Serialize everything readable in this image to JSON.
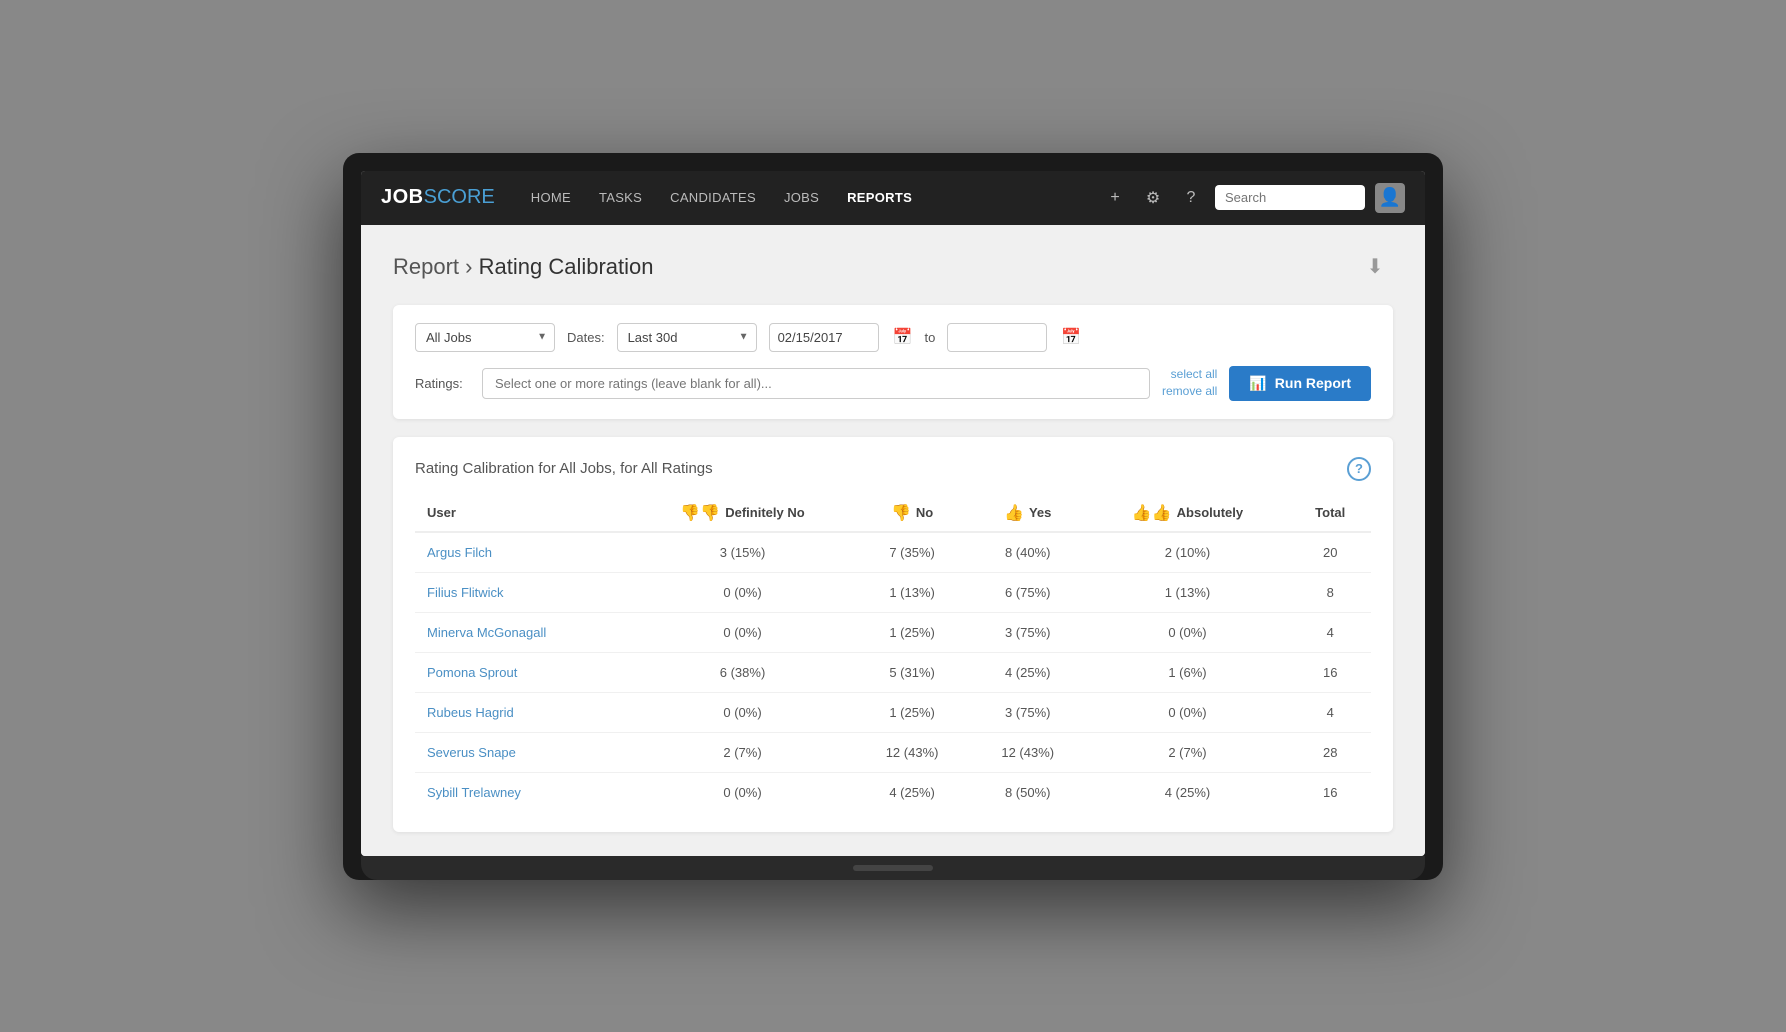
{
  "app": {
    "logo_job": "JOB",
    "logo_score": "SCORE"
  },
  "nav": {
    "links": [
      {
        "label": "HOME",
        "active": false
      },
      {
        "label": "TASKS",
        "active": false
      },
      {
        "label": "CANDIDATES",
        "active": false
      },
      {
        "label": "JOBS",
        "active": false
      },
      {
        "label": "REPORTS",
        "active": true
      }
    ],
    "search_placeholder": "Search",
    "icons": {
      "add": "+",
      "settings": "⚙",
      "help": "?"
    }
  },
  "breadcrumb": {
    "parent": "Report",
    "separator": ">",
    "current": "Rating Calibration"
  },
  "filters": {
    "jobs_options": [
      "All Jobs"
    ],
    "jobs_selected": "All Jobs",
    "dates_label": "Dates:",
    "date_range_options": [
      "Last 30d"
    ],
    "date_range_selected": "Last 30d",
    "date_from": "02/15/2017",
    "date_to": "",
    "to_label": "to",
    "ratings_label": "Ratings:",
    "ratings_placeholder": "Select one or more ratings (leave blank for all)...",
    "select_all": "select all",
    "remove_all": "remove all",
    "run_report_label": "Run Report"
  },
  "table": {
    "title": "Rating Calibration for All Jobs, for All Ratings",
    "columns": [
      {
        "key": "user",
        "label": "User",
        "icon": null
      },
      {
        "key": "definitely_no",
        "label": "Definitely No",
        "icon": "👎👎"
      },
      {
        "key": "no",
        "label": "No",
        "icon": "👎"
      },
      {
        "key": "yes",
        "label": "Yes",
        "icon": "👍"
      },
      {
        "key": "absolutely",
        "label": "Absolutely",
        "icon": "👍👍"
      },
      {
        "key": "total",
        "label": "Total",
        "icon": null
      }
    ],
    "rows": [
      {
        "user": "Argus Filch",
        "definitely_no": "3 (15%)",
        "no": "7 (35%)",
        "yes": "8 (40%)",
        "absolutely": "2 (10%)",
        "total": "20"
      },
      {
        "user": "Filius Flitwick",
        "definitely_no": "0 (0%)",
        "no": "1 (13%)",
        "yes": "6 (75%)",
        "absolutely": "1 (13%)",
        "total": "8"
      },
      {
        "user": "Minerva McGonagall",
        "definitely_no": "0 (0%)",
        "no": "1 (25%)",
        "yes": "3 (75%)",
        "absolutely": "0 (0%)",
        "total": "4"
      },
      {
        "user": "Pomona Sprout",
        "definitely_no": "6 (38%)",
        "no": "5 (31%)",
        "yes": "4 (25%)",
        "absolutely": "1 (6%)",
        "total": "16"
      },
      {
        "user": "Rubeus Hagrid",
        "definitely_no": "0 (0%)",
        "no": "1 (25%)",
        "yes": "3 (75%)",
        "absolutely": "0 (0%)",
        "total": "4"
      },
      {
        "user": "Severus Snape",
        "definitely_no": "2 (7%)",
        "no": "12 (43%)",
        "yes": "12 (43%)",
        "absolutely": "2 (7%)",
        "total": "28"
      },
      {
        "user": "Sybill Trelawney",
        "definitely_no": "0 (0%)",
        "no": "4 (25%)",
        "yes": "8 (50%)",
        "absolutely": "4 (25%)",
        "total": "16"
      }
    ]
  }
}
